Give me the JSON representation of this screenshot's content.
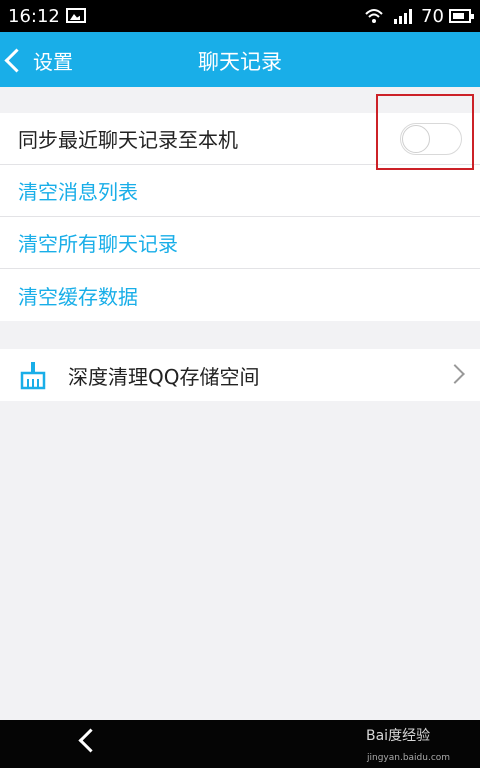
{
  "status_bar": {
    "time": "16:12",
    "battery": "70"
  },
  "header": {
    "back_label": "设置",
    "title": "聊天记录"
  },
  "sync_row": {
    "label": "同步最近聊天记录至本机",
    "toggle_state": "off"
  },
  "actions": [
    {
      "label": "清空消息列表"
    },
    {
      "label": "清空所有聊天记录"
    },
    {
      "label": "清空缓存数据"
    }
  ],
  "deep_clean": {
    "label": "深度清理QQ存储空间"
  },
  "colors": {
    "accent": "#19aee8",
    "highlight": "#cc2127"
  },
  "watermark": {
    "main": "Bai度经验",
    "url": "jingyan.baidu.com"
  }
}
